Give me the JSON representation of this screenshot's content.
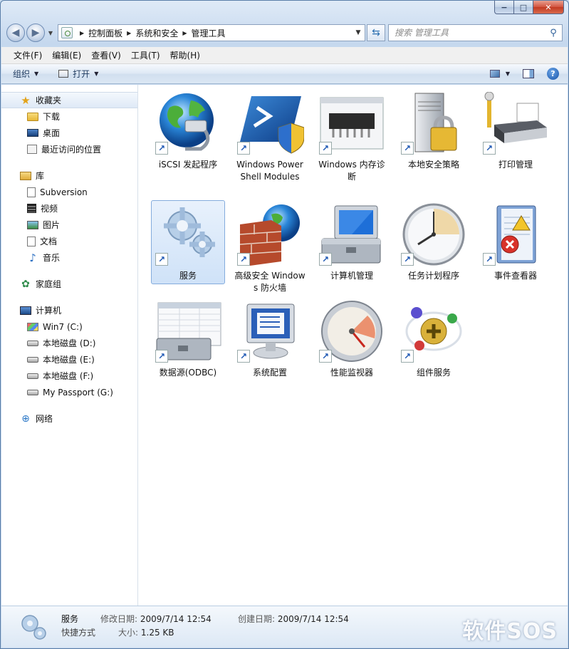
{
  "window": {
    "controls": {
      "minimize": "−",
      "maximize": "□",
      "close": "✕"
    }
  },
  "address": {
    "crumbs": [
      "控制面板",
      "系统和安全",
      "管理工具"
    ]
  },
  "search": {
    "placeholder": "搜索 管理工具"
  },
  "menu": [
    "文件(F)",
    "编辑(E)",
    "查看(V)",
    "工具(T)",
    "帮助(H)"
  ],
  "toolbar": {
    "organize": "组织",
    "open": "打开"
  },
  "navpane": {
    "favorites": {
      "label": "收藏夹",
      "items": [
        "下载",
        "桌面",
        "最近访问的位置"
      ]
    },
    "libraries": {
      "label": "库",
      "items": [
        "Subversion",
        "视频",
        "图片",
        "文档",
        "音乐"
      ]
    },
    "homegroup": {
      "label": "家庭组"
    },
    "computer": {
      "label": "计算机",
      "items": [
        "Win7 (C:)",
        "本地磁盘 (D:)",
        "本地磁盘 (E:)",
        "本地磁盘 (F:)",
        "My Passport (G:)"
      ]
    },
    "network": {
      "label": "网络"
    }
  },
  "files": [
    {
      "label": "iSCSI 发起程序",
      "icon": "globe-network-icon"
    },
    {
      "label": "Windows PowerShell Modules",
      "icon": "powershell-icon"
    },
    {
      "label": "Windows 内存诊断",
      "icon": "memory-chip-icon"
    },
    {
      "label": "本地安全策略",
      "icon": "server-lock-icon"
    },
    {
      "label": "打印管理",
      "icon": "printer-icon"
    },
    {
      "label": "服务",
      "icon": "gears-icon",
      "selected": true
    },
    {
      "label": "高级安全 Windows 防火墙",
      "icon": "firewall-icon"
    },
    {
      "label": "计算机管理",
      "icon": "computer-toolbox-icon"
    },
    {
      "label": "任务计划程序",
      "icon": "clock-icon"
    },
    {
      "label": "事件查看器",
      "icon": "event-log-icon"
    },
    {
      "label": "数据源(ODBC)",
      "icon": "database-toolbox-icon"
    },
    {
      "label": "系统配置",
      "icon": "monitor-config-icon"
    },
    {
      "label": "性能监视器",
      "icon": "gauge-icon"
    },
    {
      "label": "组件服务",
      "icon": "components-icon"
    }
  ],
  "details": {
    "name": "服务",
    "type": "快捷方式",
    "modified_label": "修改日期:",
    "modified": "2009/7/14 12:54",
    "size_label": "大小:",
    "size": "1.25 KB",
    "created_label": "创建日期:",
    "created": "2009/7/14 12:54"
  },
  "watermark": "软件SOS"
}
